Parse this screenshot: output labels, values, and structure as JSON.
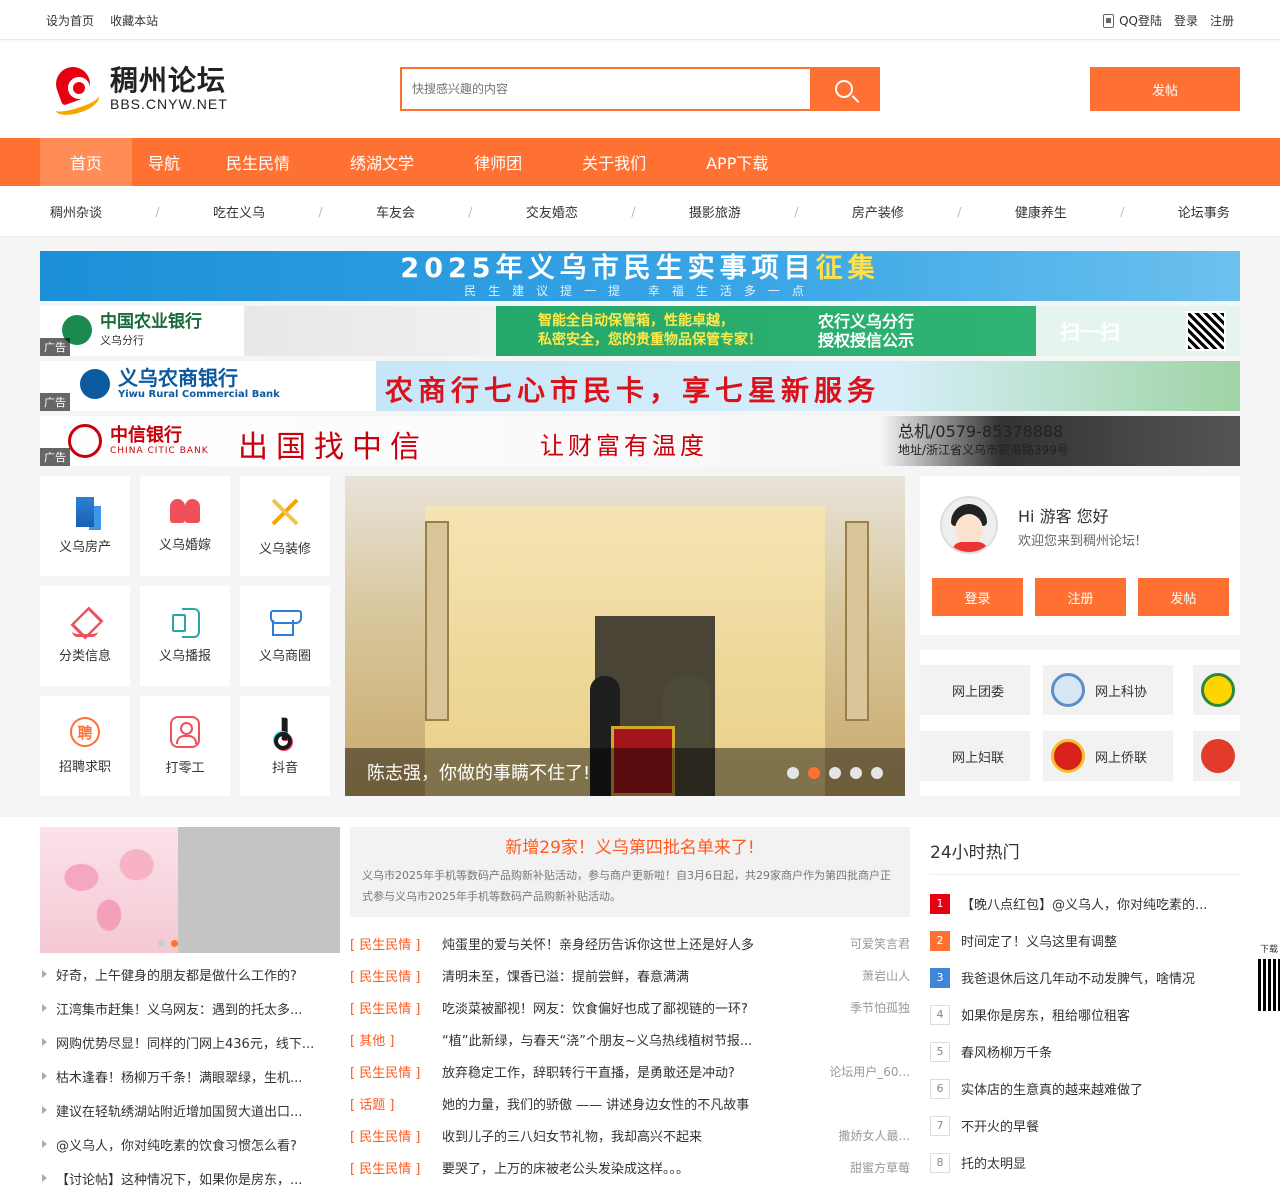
{
  "topbar": {
    "set_home": "设为首页",
    "bookmark": "收藏本站",
    "qq_login": "QQ登陆",
    "login": "登录",
    "register": "注册"
  },
  "header": {
    "logo_cn": "稠州论坛",
    "logo_en": "BBS.CNYW.NET",
    "search_placeholder": "快搜感兴趣的内容",
    "post_button": "发帖"
  },
  "mainnav": [
    "首页",
    "导航",
    "民生民情",
    "绣湖文学",
    "律师团",
    "关于我们",
    "APP下载"
  ],
  "subnav": [
    "稠州杂谈",
    "吃在义乌",
    "车友会",
    "交友婚恋",
    "摄影旅游",
    "房产装修",
    "健康养生",
    "论坛事务"
  ],
  "subnav_sep": "/",
  "banners": {
    "top_line1_a": "2025年义乌市民生实事项目",
    "top_line1_b": "征集",
    "top_line2": "民生建议提一提 幸福生活多一点",
    "ad_tag": "广告",
    "abc_name": "中国农业银行",
    "abc_sub": "义乌分行",
    "abc_msg1a": "智能全自动保管箱，性能卓越，",
    "abc_msg1b": "私密安全，您的贵重物品保管专家！",
    "abc_msg2a": "农行义乌分行",
    "abc_msg2b": "授权授信公示",
    "abc_msg3": "扫一扫",
    "rcb_name": "义乌农商银行",
    "rcb_sub": "Yiwu Rural Commercial Bank",
    "rcb_slogan": "农商行七心市民卡，享七星新服务",
    "citic_name": "中信银行",
    "citic_sub": "CHINA CITIC BANK",
    "citic_slogan1": "出国找中信",
    "citic_slogan2": "让财富有温度",
    "citic_phone": "总机/0579-85378888",
    "citic_addr": "地址/浙江省义乌市银海路399号"
  },
  "grid": [
    {
      "label": "义乌房产",
      "icon": "building-icon"
    },
    {
      "label": "义乌婚嫁",
      "icon": "couple-icon"
    },
    {
      "label": "义乌装修",
      "icon": "tools-icon"
    },
    {
      "label": "分类信息",
      "icon": "layers-icon"
    },
    {
      "label": "义乌播报",
      "icon": "horn-icon"
    },
    {
      "label": "义乌商圈",
      "icon": "shop-icon"
    },
    {
      "label": "招聘求职",
      "icon": "recruit-icon",
      "glyph": "聘"
    },
    {
      "label": "打零工",
      "icon": "worker-icon"
    },
    {
      "label": "抖音",
      "icon": "tiktok-icon"
    }
  ],
  "slider": {
    "caption": "陈志强，你做的事瞒不住了!",
    "active_dot": 1,
    "dot_count": 5
  },
  "user": {
    "hello": "Hi 游客 您好",
    "welcome": "欢迎您来到稠州论坛!",
    "login": "登录",
    "register": "注册",
    "post": "发帖"
  },
  "orgs": [
    "网上团委",
    "网上科协",
    "网上妇联",
    "网上侨联"
  ],
  "left_list": [
    "好奇，上午健身的朋友都是做什么工作的?",
    "江湾集市赶集！义乌网友：遇到的托太多...",
    "网购优势尽显！同样的门网上436元，线下...",
    "枯木逢春！杨柳万千条！满眼翠绿，生机...",
    "建议在轻轨绣湖站附近增加国贸大道出口...",
    "@义乌人，你对纯吃素的饮食习惯怎么看?",
    "【讨论帖】这种情况下，如果你是房东，..."
  ],
  "headline": {
    "title": "新增29家！义乌第四批名单来了!",
    "desc": "义乌市2025年手机等数码产品购新补贴活动，参与商户更新啦！自3月6日起，共29家商户作为第四批商户正式参与义乌市2025年手机等数码产品购新补贴活动。"
  },
  "mid_list": [
    {
      "cat": "[ 民生民情 ]",
      "title": "炖蛋里的爱与关怀！亲身经历告诉你这世上还是好人多",
      "author": "可爱笑言君"
    },
    {
      "cat": "[ 民生民情 ]",
      "title": "清明未至，馃香已溢：提前尝鲜，春意满满",
      "author": "萧岩山人"
    },
    {
      "cat": "[ 民生民情 ]",
      "title": "吃淡菜被鄙视！网友：饮食偏好也成了鄙视链的一环?",
      "author": "季节怕孤独"
    },
    {
      "cat": "[ 其他 ]",
      "title": "“植”此新绿，与春天“浇”个朋友~义乌热线植树节报...",
      "author": ""
    },
    {
      "cat": "[ 民生民情 ]",
      "title": "放弃稳定工作，辞职转行干直播，是勇敢还是冲动?",
      "author": "论坛用户_60..."
    },
    {
      "cat": "[ 话题 ]",
      "title": "她的力量，我们的骄傲 —— 讲述身边女性的不凡故事",
      "author": ""
    },
    {
      "cat": "[ 民生民情 ]",
      "title": "收到儿子的三八妇女节礼物，我却高兴不起来",
      "author": "撒娇女人最..."
    },
    {
      "cat": "[ 民生民情 ]",
      "title": "要哭了，上万的床被老公头发染成这样。。。",
      "author": "甜蜜方草莓"
    }
  ],
  "hot": {
    "title": "24小时热门",
    "items": [
      "【晚八点红包】@义乌人，你对纯吃素的...",
      "时间定了！义乌这里有调整",
      "我爸退休后这几年动不动发脾气，啥情况",
      "如果你是房东，租给哪位租客",
      "春风杨柳万千条",
      "实体店的生意真的越来越难做了",
      "不开火的早餐",
      "托的太明显"
    ],
    "ranks": [
      "1",
      "2",
      "3",
      "4",
      "5",
      "6",
      "7",
      "8"
    ]
  },
  "side": {
    "download": "下载"
  },
  "colors": {
    "accent": "#ff7132",
    "rank1": "#e60012",
    "rank3": "#3d86d8"
  }
}
